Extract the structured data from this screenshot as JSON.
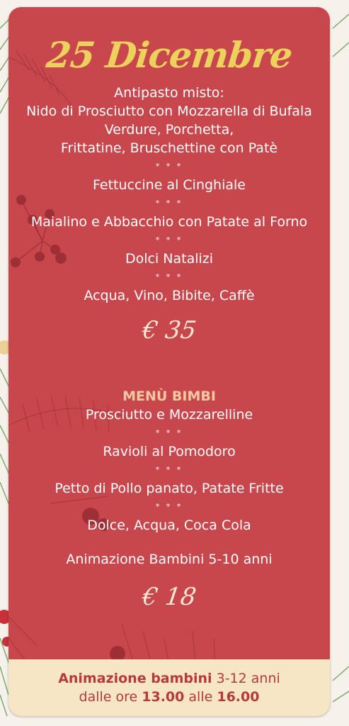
{
  "colors": {
    "card_background": "#c8474c",
    "title": "#ecd25c",
    "text": "#ffffff",
    "kids_title": "#f3c9a4",
    "footer_background": "#f7e6c6",
    "footer_text": "#b63a3a"
  },
  "decorations": [
    "pine-branch",
    "red-berries",
    "ornament-ball"
  ],
  "menu": {
    "title": "25 Dicembre",
    "antipasto": {
      "heading": "Antipasto misto:",
      "lines": [
        "Nido di Prosciutto con Mozzarella di Bufala",
        "Verdure, Porchetta,",
        "Frittatine, Bruschettine con Patè"
      ]
    },
    "separator": "* * *",
    "primo": "Fettuccine al Cinghiale",
    "secondo": "Maialino e Abbacchio con Patate al Forno",
    "dolce": "Dolci Natalizi",
    "bevande": "Acqua, Vino, Bibite, Caffè",
    "price": "€ 35"
  },
  "kids_menu": {
    "title": "MENÙ BIMBI",
    "items": [
      "Prosciutto e Mozzarelline",
      "Ravioli al Pomodoro",
      "Petto di Pollo panato, Patate Fritte",
      "Dolce, Acqua, Coca Cola"
    ],
    "entertainment": "Animazione Bambini 5-10 anni",
    "price": "€ 18"
  },
  "footer": {
    "line1_bold": "Animazione bambini",
    "line1_rest": " 3-12 anni",
    "line2_pre": "dalle ore ",
    "line2_from": "13.00",
    "line2_mid": " alle ",
    "line2_to": "16.00"
  }
}
